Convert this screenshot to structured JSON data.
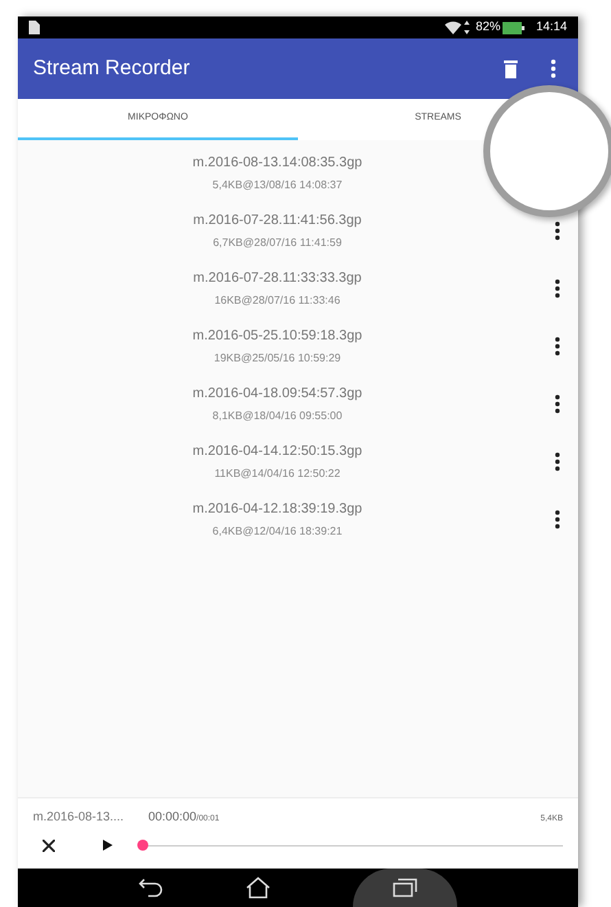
{
  "status_bar": {
    "battery": "82%",
    "time": "14:14"
  },
  "app_bar": {
    "title": "Stream Recorder"
  },
  "tabs": [
    {
      "label": "ΜΙΚΡΟΦΩΝΟ",
      "selected": true
    },
    {
      "label": "STREAMS",
      "selected": false
    }
  ],
  "recordings": [
    {
      "name": "m.2016-08-13.14:08:35.3gp",
      "details": "5,4KB@13/08/16 14:08:37"
    },
    {
      "name": "m.2016-07-28.11:41:56.3gp",
      "details": "6,7KB@28/07/16 11:41:59"
    },
    {
      "name": "m.2016-07-28.11:33:33.3gp",
      "details": "16KB@28/07/16 11:33:46"
    },
    {
      "name": "m.2016-05-25.10:59:18.3gp",
      "details": "19KB@25/05/16 10:59:29"
    },
    {
      "name": "m.2016-04-18.09:54:57.3gp",
      "details": "8,1KB@18/04/16 09:55:00"
    },
    {
      "name": "m.2016-04-14.12:50:15.3gp",
      "details": "11KB@14/04/16 12:50:22"
    },
    {
      "name": "m.2016-04-12.18:39:19.3gp",
      "details": "6,4KB@12/04/16 18:39:21"
    }
  ],
  "player": {
    "file": "m.2016-08-13....",
    "position": "00:00:00",
    "duration": "/00:01",
    "size": "5,4KB",
    "level": 0
  }
}
